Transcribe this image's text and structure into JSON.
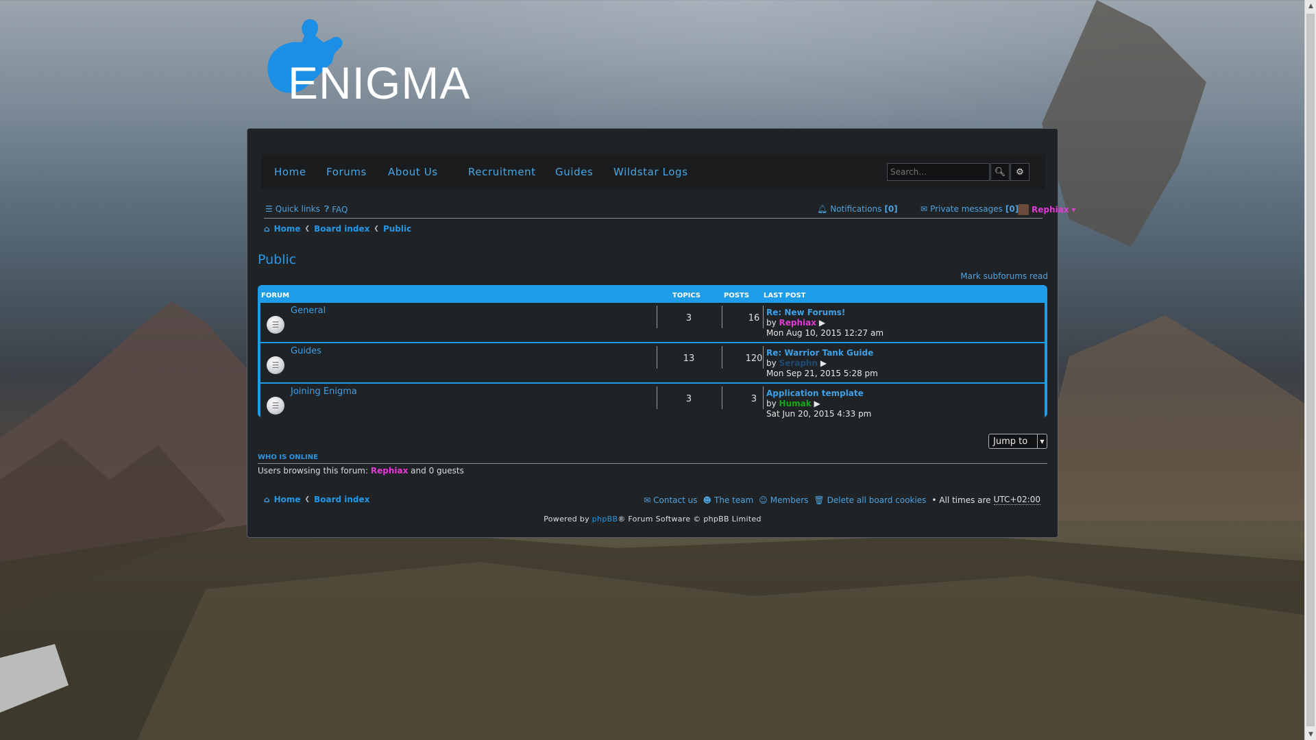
{
  "brand": {
    "name": "ENIGMA",
    "logo_icon": "puzzle-figure-logo",
    "accent": "#1f9ce8"
  },
  "nav": {
    "items": [
      "Home",
      "Forums",
      "About Us",
      "Recruitment",
      "Guides",
      "Wildstar Logs"
    ],
    "search_placeholder": "Search…"
  },
  "toolbar": {
    "quick_links": "Quick links",
    "faq": "FAQ",
    "notifications": "Notifications",
    "notifications_count": "[0]",
    "private_messages": "Private messages",
    "pm_count": "[0]",
    "username": "Rephiax",
    "user_caret": "▾"
  },
  "breadcrumb": [
    "Home",
    "Board index",
    "Public"
  ],
  "page": {
    "title": "Public",
    "mark_read": "Mark subforums read"
  },
  "table": {
    "headers": {
      "forum": "FORUM",
      "topics": "TOPICS",
      "posts": "POSTS",
      "last_post": "LAST POST"
    },
    "rows": [
      {
        "name": "General",
        "topics": "3",
        "posts": "16",
        "lp_title": "Re: New Forums!",
        "lp_by": "by",
        "lp_user": "Rephiax",
        "lp_date": "Mon Aug 10, 2015 12:27 am"
      },
      {
        "name": "Guides",
        "topics": "13",
        "posts": "120",
        "lp_title": "Re: Warrior Tank Guide",
        "lp_by": "by",
        "lp_user": "Seraphn",
        "lp_date": "Mon Sep 21, 2015 5:28 pm"
      },
      {
        "name": "Joining Enigma",
        "topics": "3",
        "posts": "3",
        "lp_title": "Application template",
        "lp_by": "by",
        "lp_user": "Humak",
        "lp_date": "Sat Jun 20, 2015 4:33 pm"
      }
    ]
  },
  "jump_to": "Jump to",
  "online": {
    "heading": "WHO IS ONLINE",
    "prefix": "Users browsing this forum:",
    "user": "Rephiax",
    "suffix": "and 0 guests"
  },
  "footer": {
    "breadcrumb": [
      "Home",
      "Board index"
    ],
    "contact": "Contact us",
    "team": "The team",
    "members": "Members",
    "cookies": "Delete all board cookies",
    "times_prefix": "• All times are",
    "timezone": "UTC+02:00",
    "powered_prefix": "Powered by",
    "powered_link": "phpBB",
    "powered_suffix": "® Forum Software © phpBB Limited"
  },
  "colors": {
    "user_admin": "#e13bd4",
    "user_member": "#16a71a",
    "link": "#3ea0e6"
  }
}
